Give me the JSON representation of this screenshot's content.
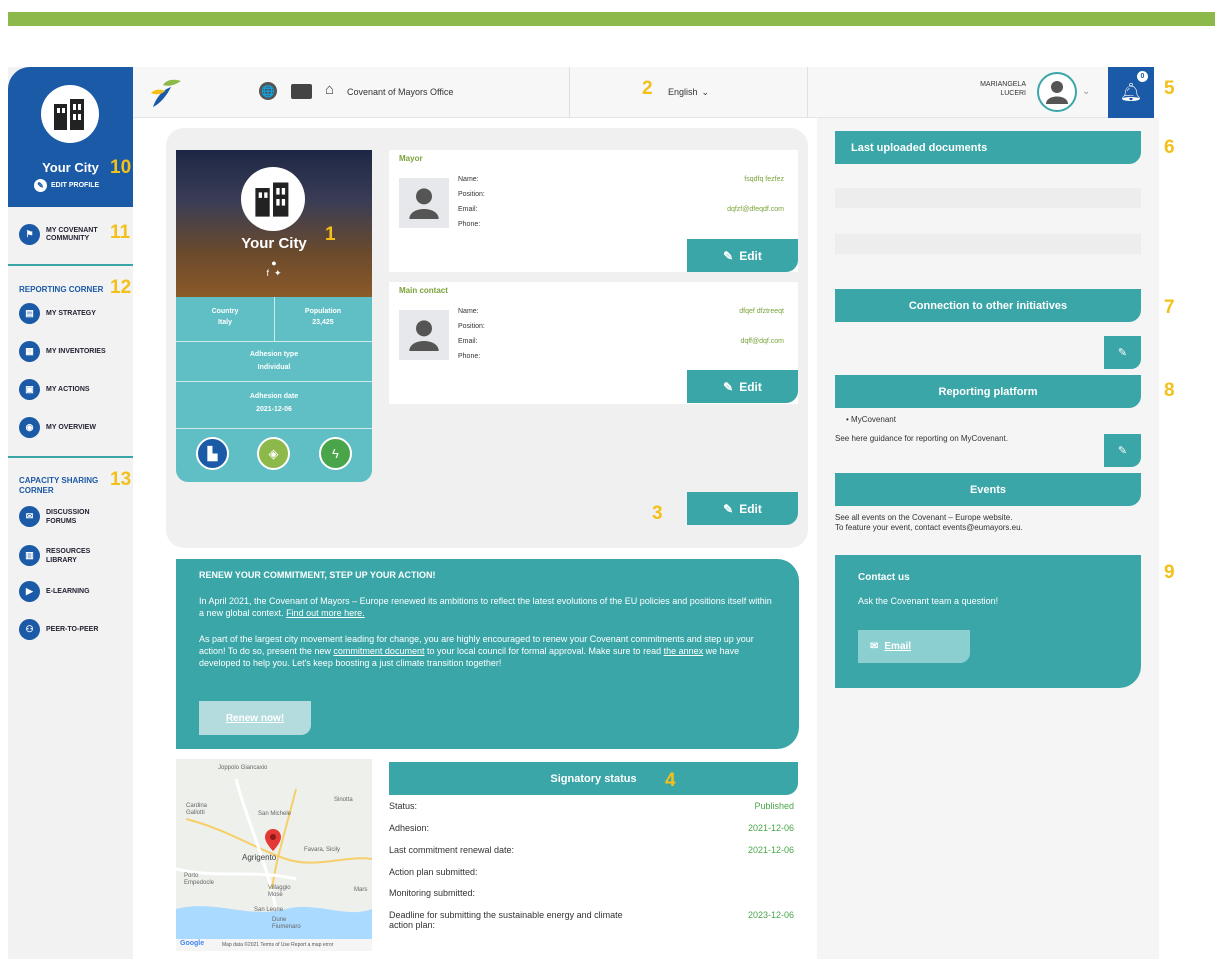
{
  "header": {
    "office_label": "Covenant of Mayors Office",
    "language": "English",
    "user_name_line1": "MARIANGELA",
    "user_name_line2": "LUCERI",
    "notification_count": "0"
  },
  "markers": [
    "1",
    "1",
    "2",
    "3",
    "4",
    "5",
    "6",
    "7",
    "8",
    "9",
    "10",
    "11",
    "12",
    "13"
  ],
  "sidebar": {
    "city_name": "Your City",
    "edit_profile": "EDIT PROFILE",
    "community_line1": "MY COVENANT",
    "community_line2": "COMMUNITY",
    "reporting_title": "REPORTING CORNER",
    "reporting_items": [
      "MY STRATEGY",
      "MY INVENTORIES",
      "MY ACTIONS",
      "MY OVERVIEW"
    ],
    "capacity_title_line1": "CAPACITY SHARING",
    "capacity_title_line2": "CORNER",
    "capacity_items": [
      {
        "line1": "DISCUSSION",
        "line2": "FORUMS"
      },
      {
        "line1": "RESOURCES",
        "line2": "LIBRARY"
      },
      {
        "line1": "E-LEARNING",
        "line2": ""
      },
      {
        "line1": "PEER-TO-PEER",
        "line2": ""
      }
    ]
  },
  "city_card": {
    "name": "Your City",
    "country_label": "Country",
    "country_value": "Italy",
    "population_label": "Population",
    "population_value": "23,425",
    "adhesion_type_label": "Adhesion type",
    "adhesion_type_value": "Individual",
    "adhesion_date_label": "Adhesion date",
    "adhesion_date_value": "2021-12-06"
  },
  "mayor": {
    "title": "Mayor",
    "name_label": "Name:",
    "position_label": "Position:",
    "email_label": "Email:",
    "phone_label": "Phone:",
    "name_value": "fsqdfq fezfez",
    "email_value": "dqfzf@dfeqdf.com",
    "edit_label": "Edit"
  },
  "main_contact": {
    "title": "Main contact",
    "name_label": "Name:",
    "position_label": "Position:",
    "email_label": "Email:",
    "phone_label": "Phone:",
    "name_value": "dfqef dfztreeqt",
    "email_value": "dqff@dqf.com",
    "edit_label": "Edit"
  },
  "panel_edit_label": "Edit",
  "renew": {
    "heading": "RENEW YOUR COMMITMENT, STEP UP YOUR ACTION!",
    "p1_a": "In April 2021, the Covenant of Mayors – Europe renewed its ambitions to reflect the latest evolutions of the EU policies and positions itself within a new global context. ",
    "p1_link": "Find out more here.",
    "p2_a": "As part of the largest city movement leading for change, you are highly encouraged to renew your Covenant commitments and step up your action! To do so, present the new ",
    "p2_link1": "commitment document",
    "p2_b": " to your local council for formal approval. Make sure to read ",
    "p2_link2": "the annex",
    "p2_c": " we have developed to help you. Let's keep boosting a just climate transition together!",
    "button": "Renew now!"
  },
  "map": {
    "places": [
      "Joppolo Giancaxio",
      "Cardina Gallotti",
      "San Michele",
      "Sinotta",
      "Agrigento",
      "Favara, Sicily",
      "Porto Empedocle",
      "Villaggio Mosè",
      "Mars",
      "San Leone",
      "Dune Fiumenaro"
    ],
    "footer": "Map data ©2021  Terms of Use  Report a map error",
    "brand": "Google"
  },
  "signatory": {
    "title": "Signatory status",
    "rows": [
      {
        "label": "Status:",
        "value": "Published"
      },
      {
        "label": "Adhesion:",
        "value": "2021-12-06"
      },
      {
        "label": "Last commitment renewal date:",
        "value": "2021-12-06"
      },
      {
        "label": "Action plan submitted:",
        "value": ""
      },
      {
        "label": "Monitoring submitted:",
        "value": ""
      },
      {
        "label": "Deadline for submitting the sustainable energy and climate action plan:",
        "value": "2023-12-06"
      }
    ]
  },
  "right": {
    "docs_title": "Last uploaded documents",
    "connection_title": "Connection to other initiatives",
    "reporting_title": "Reporting platform",
    "reporting_item": "MyCovenant",
    "reporting_guidance": "See here guidance for reporting on MyCovenant.",
    "events_title": "Events",
    "events_line1": "See all events on the Covenant – Europe website.",
    "events_line2": "To feature your event, contact events@eumayors.eu.",
    "contact_title": "Contact us",
    "contact_text": "Ask the Covenant team a question!",
    "email_button": "Email"
  },
  "colors": {
    "brand_blue": "#1b5aa6",
    "teal": "#3aa6a8",
    "green_bar": "#8db84a",
    "marker_yellow": "#f3c01a",
    "value_green": "#7aa33a"
  }
}
